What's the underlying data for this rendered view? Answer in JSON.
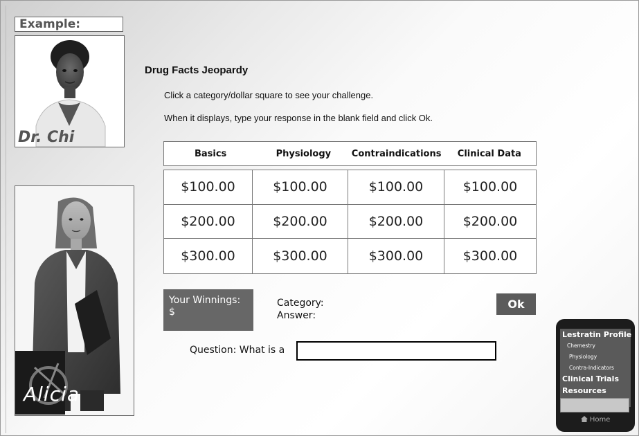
{
  "example_label": "Example:",
  "chi": {
    "name": "Dr. Chi"
  },
  "alicia": {
    "name": "Alicia"
  },
  "game": {
    "title": "Drug Facts Jeopardy",
    "instruction1": "Click a category/dollar square to see your challenge.",
    "instruction2": "When it displays, type your response in the blank field and click Ok."
  },
  "board": {
    "categories": [
      "Basics",
      "Physiology",
      "Contraindications",
      "Clinical Data"
    ],
    "rows": [
      [
        "$100.00",
        "$100.00",
        "$100.00",
        "$100.00"
      ],
      [
        "$200.00",
        "$200.00",
        "$200.00",
        "$200.00"
      ],
      [
        "$300.00",
        "$300.00",
        "$300.00",
        "$300.00"
      ]
    ]
  },
  "winnings": {
    "label": "Your Winnings:",
    "value": "$"
  },
  "category_label": "Category:",
  "answer_label": "Answer:",
  "ok_label": "Ok",
  "question": {
    "label": "Question: What is a",
    "value": ""
  },
  "phone": {
    "items": [
      "Lestratin Profile",
      "Chemestry",
      "Physiology",
      "Contra-Indicators",
      "Clinical Trials",
      "Resources"
    ],
    "home": "Home"
  }
}
